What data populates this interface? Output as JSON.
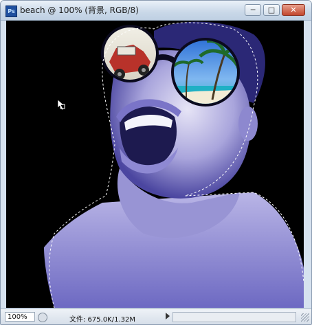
{
  "window": {
    "title": "beach @ 100% (背景, RGB/8)",
    "app_icon": "ps-app-icon",
    "app_icon_text": "Ps"
  },
  "controls": {
    "minimize_icon": "minimize-icon",
    "maximize_icon": "maximize-icon",
    "close_icon": "close-icon"
  },
  "canvas": {
    "content": "photo of laughing woman wearing round sunglasses; left lens shows a red jeep, right lens shows a tropical beach with palm trees; marching-ants selection outline around the figure",
    "background_color": "#000000",
    "tint_color": "#6f6bc4"
  },
  "status": {
    "zoom": "100%",
    "doc_info": "文件: 675.0K/1.32M"
  }
}
